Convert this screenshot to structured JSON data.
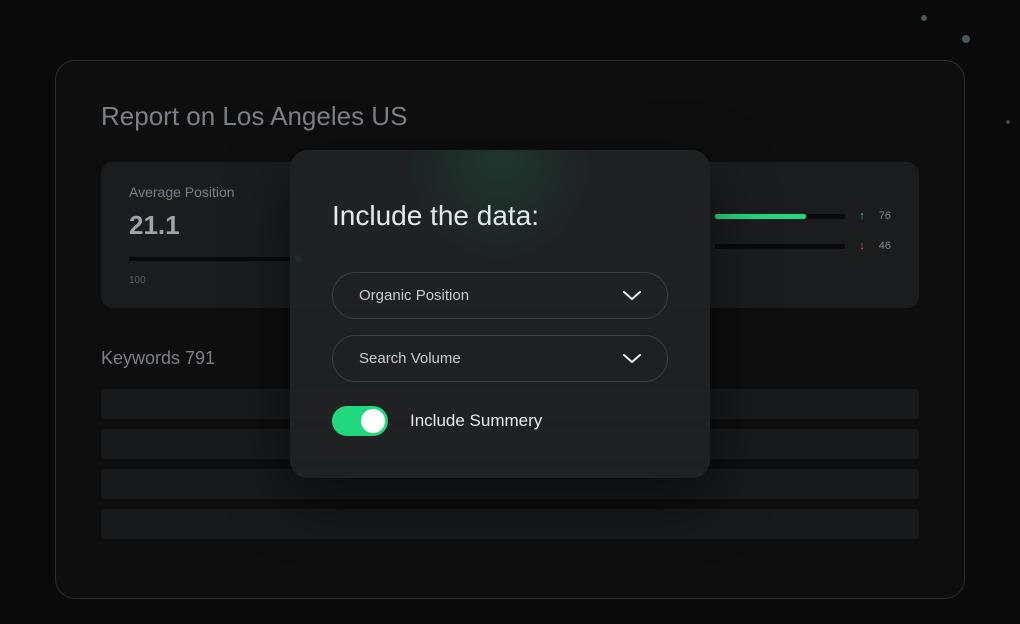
{
  "report": {
    "title": "Report on Los Angeles US"
  },
  "card": {
    "avg_label": "Average Position",
    "avg_value": "21.1",
    "progress_caption": "100",
    "metric_up_value": "76",
    "metric_down_value": "46"
  },
  "keywords": {
    "label": "Keywords 791"
  },
  "modal": {
    "title": "Include the data:",
    "dropdown1": "Organic Position",
    "dropdown2": "Search Volume",
    "toggle_label": "Include Summery"
  }
}
